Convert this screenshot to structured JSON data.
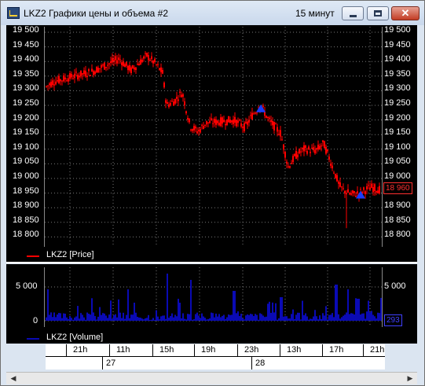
{
  "window": {
    "title": "LKZ2 Графики цены и объема #2",
    "timeframe": "15 минут",
    "close_glyph": "✕"
  },
  "price_pane": {
    "y_ticks": [
      "19 500",
      "19 450",
      "19 400",
      "19 350",
      "19 300",
      "19 250",
      "19 200",
      "19 150",
      "19 100",
      "19 050",
      "19 000",
      "18 950",
      "18 900",
      "18 850",
      "18 800"
    ],
    "last_price_tag": "18 960",
    "legend": "LKZ2 [Price]",
    "line_color": "#ff0000",
    "tag_color": "#ff0000"
  },
  "volume_pane": {
    "y_ticks": [
      "5 000",
      "0"
    ],
    "last_volume_tag": "293",
    "legend": "LKZ2 [Volume]",
    "bar_color": "#0a0ab4",
    "tag_color": "#2020ff"
  },
  "time_axis": {
    "hours": [
      "21h",
      "11h",
      "15h",
      "19h",
      "23h",
      "13h",
      "17h",
      "21h"
    ],
    "dates": [
      "27",
      "28"
    ]
  },
  "markers": {
    "color": "#1a3cff"
  }
}
